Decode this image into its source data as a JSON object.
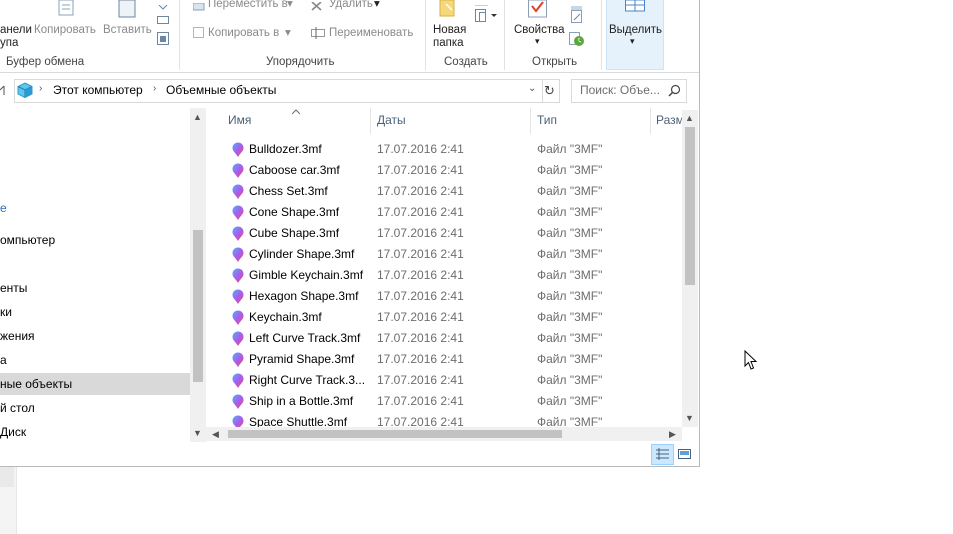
{
  "ribbon": {
    "clipboard": {
      "pin_label_1": "анели",
      "pin_label_2": "упа",
      "copy_label": "Копировать",
      "paste_label": "Вставить",
      "group_label": "Буфер обмена"
    },
    "organize": {
      "move_label": "Переместить в",
      "copy_to_label": "Копировать в",
      "delete_label": "Удалить",
      "rename_label": "Переименовать",
      "group_label": "Упорядочить"
    },
    "create": {
      "new_folder_label_1": "Новая",
      "new_folder_label_2": "папка",
      "group_label": "Создать"
    },
    "open": {
      "properties_label": "Свойства",
      "group_label": "Открыть"
    },
    "select": {
      "select_label": "Выделить"
    }
  },
  "address": {
    "crumbs": [
      "Этот компьютер",
      "Объемные объекты"
    ]
  },
  "search": {
    "placeholder": "Поиск: Объе..."
  },
  "nav": {
    "items": [
      {
        "label": "е",
        "selected": false
      },
      {
        "label": "омпьютер",
        "selected": false
      },
      {
        "label": "енты",
        "selected": false
      },
      {
        "label": "ки",
        "selected": false
      },
      {
        "label": "жения",
        "selected": false
      },
      {
        "label": "а",
        "selected": false
      },
      {
        "label": "ные объекты",
        "selected": true
      },
      {
        "label": "й стол",
        "selected": false
      },
      {
        "label": "Диск",
        "selected": false
      }
    ]
  },
  "columns": {
    "name": "Имя",
    "date": "Даты",
    "type": "Тип",
    "size": "Разм"
  },
  "files": [
    {
      "name": "Bulldozer.3mf",
      "date": "17.07.2016 2:41",
      "type": "Файл \"3MF\""
    },
    {
      "name": "Caboose car.3mf",
      "date": "17.07.2016 2:41",
      "type": "Файл \"3MF\""
    },
    {
      "name": "Chess Set.3mf",
      "date": "17.07.2016 2:41",
      "type": "Файл \"3MF\""
    },
    {
      "name": "Cone Shape.3mf",
      "date": "17.07.2016 2:41",
      "type": "Файл \"3MF\""
    },
    {
      "name": "Cube Shape.3mf",
      "date": "17.07.2016 2:41",
      "type": "Файл \"3MF\""
    },
    {
      "name": "Cylinder Shape.3mf",
      "date": "17.07.2016 2:41",
      "type": "Файл \"3MF\""
    },
    {
      "name": "Gimble Keychain.3mf",
      "date": "17.07.2016 2:41",
      "type": "Файл \"3MF\""
    },
    {
      "name": "Hexagon Shape.3mf",
      "date": "17.07.2016 2:41",
      "type": "Файл \"3MF\""
    },
    {
      "name": "Keychain.3mf",
      "date": "17.07.2016 2:41",
      "type": "Файл \"3MF\""
    },
    {
      "name": "Left Curve Track.3mf",
      "date": "17.07.2016 2:41",
      "type": "Файл \"3MF\""
    },
    {
      "name": "Pyramid Shape.3mf",
      "date": "17.07.2016 2:41",
      "type": "Файл \"3MF\""
    },
    {
      "name": "Right Curve Track.3...",
      "date": "17.07.2016 2:41",
      "type": "Файл \"3MF\""
    },
    {
      "name": "Ship in a Bottle.3mf",
      "date": "17.07.2016 2:41",
      "type": "Файл \"3MF\""
    },
    {
      "name": "Space Shuttle.3mf",
      "date": "17.07.2016 2:41",
      "type": "Файл \"3MF\""
    }
  ],
  "colors": {
    "accent": "#cce8ff",
    "selected_nav": "#d9d9d9",
    "header_text": "#4c607a"
  }
}
